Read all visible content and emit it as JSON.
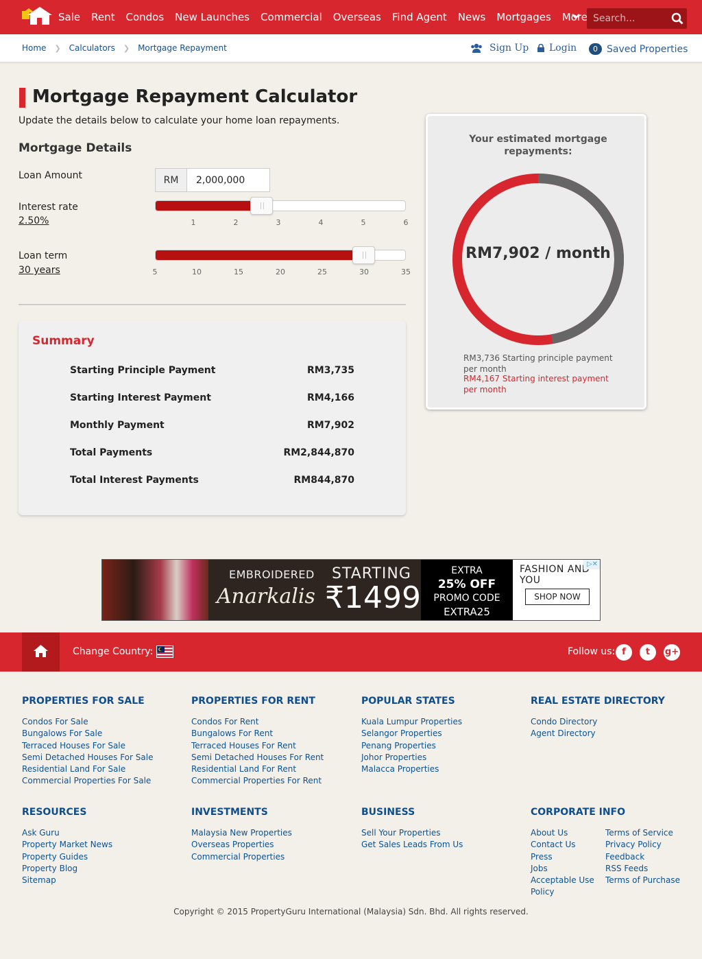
{
  "nav": {
    "links": [
      "Sale",
      "Rent",
      "Condos",
      "New Launches",
      "Commercial",
      "Overseas",
      "Find Agent",
      "News",
      "Mortgages",
      "More"
    ],
    "search_placeholder": "Search..."
  },
  "breadcrumb": [
    "Home",
    "Calculators",
    "Mortgage Repayment"
  ],
  "account": {
    "signup": "Sign Up",
    "login": "Login",
    "saved_count": "0",
    "saved": "Saved Properties"
  },
  "page": {
    "title": "Mortgage Repayment Calculator",
    "lead": "Update the details below to calculate your home loan repayments.",
    "section": "Mortgage Details"
  },
  "form": {
    "loan_amount_label": "Loan Amount",
    "currency": "RM",
    "loan_amount": "2,000,000",
    "interest_label": "Interest rate",
    "interest_value": "2.50%",
    "interest_slider": {
      "min": 0,
      "max": 6,
      "value": 2.5,
      "ticks": [
        "1",
        "2",
        "3",
        "4",
        "5",
        "6"
      ]
    },
    "term_label": "Loan term",
    "term_value": "30 years",
    "term_slider": {
      "min": 5,
      "max": 35,
      "value": 30,
      "ticks": [
        "5",
        "10",
        "15",
        "20",
        "25",
        "30",
        "35"
      ]
    }
  },
  "summary": {
    "title": "Summary",
    "rows": [
      {
        "label": "Starting Principle Payment",
        "value": "RM3,735"
      },
      {
        "label": "Starting Interest Payment",
        "value": "RM4,166"
      },
      {
        "label": "Monthly Payment",
        "value": "RM7,902"
      },
      {
        "label": "Total Payments",
        "value": "RM2,844,870"
      },
      {
        "label": "Total Interest Payments",
        "value": "RM844,870"
      }
    ]
  },
  "result": {
    "title": "Your estimated mortgage repayments:",
    "amount": "RM7,902",
    "per": "/ month",
    "principle_text": "RM3,736 Starting principle payment per month",
    "interest_text": "RM4,167 Starting interest payment per month",
    "principle_fraction": 0.4728,
    "colors": {
      "interest": "#d7262e",
      "principle": "#666666"
    }
  },
  "ad": {
    "embroidered": "EMBROIDERED",
    "anarkalis": "Anarkalis",
    "starting": "STARTING",
    "price": "₹1499/-",
    "extra": "EXTRA",
    "off": "25% OFF",
    "promo": "PROMO CODE",
    "code": "EXTRA25",
    "brand": "FASHION AND YOU",
    "shop": "SHOP NOW"
  },
  "footer": {
    "change_country": "Change Country:",
    "follow": "Follow us:",
    "columns": [
      {
        "title": "PROPERTIES FOR SALE",
        "items": [
          "Condos For Sale",
          "Bungalows For Sale",
          "Terraced Houses For Sale",
          "Semi Detached Houses For Sale",
          "Residential Land For Sale",
          "Commercial Properties For Sale"
        ]
      },
      {
        "title": "PROPERTIES FOR RENT",
        "items": [
          "Condos For Rent",
          "Bungalows For Rent",
          "Terraced Houses For Rent",
          "Semi Detached Houses For Rent",
          "Residential Land For Rent",
          "Commercial Properties For Rent"
        ]
      },
      {
        "title": "POPULAR STATES",
        "items": [
          "Kuala Lumpur Properties",
          "Selangor Properties",
          "Penang Properties",
          "Johor Properties",
          "Malacca Properties"
        ]
      },
      {
        "title": "REAL ESTATE DIRECTORY",
        "items": [
          "Condo Directory",
          "Agent Directory"
        ]
      },
      {
        "title": "RESOURCES",
        "items": [
          "Ask Guru",
          "Property Market News",
          "Property Guides",
          "Property Blog",
          "Sitemap"
        ]
      },
      {
        "title": "INVESTMENTS",
        "items": [
          "Malaysia New Properties",
          "Overseas Properties",
          "Commercial Properties"
        ]
      },
      {
        "title": "BUSINESS",
        "items": [
          "Sell Your Properties",
          "Get Sales Leads From Us"
        ]
      },
      {
        "title": "CORPORATE INFO",
        "items": [
          "About Us",
          "Contact Us",
          "Press",
          "Jobs",
          "Acceptable Use Policy"
        ]
      }
    ],
    "corporate_extra": [
      "Terms of Service",
      "Privacy Policy",
      "Feedback",
      "RSS Feeds",
      "Terms of Purchase"
    ],
    "copyright": "Copyright © 2015 PropertyGuru International (Malaysia) Sdn. Bhd. All rights reserved."
  }
}
